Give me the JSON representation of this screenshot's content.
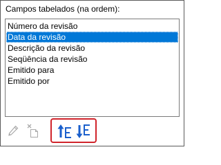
{
  "fields_group": {
    "label": "Campos tabelados (na ordem):",
    "items": [
      {
        "label": "Número da revisão",
        "selected": false
      },
      {
        "label": "Data da revisão",
        "selected": true
      },
      {
        "label": "Descrição da revisão",
        "selected": false
      },
      {
        "label": "Seqüência da revisão",
        "selected": false
      },
      {
        "label": "Emitido para",
        "selected": false
      },
      {
        "label": "Emitido por",
        "selected": false
      }
    ]
  },
  "toolbar": {
    "edit_icon": "pencil-icon",
    "delete_icon": "delete-item-icon",
    "move_up_icon": "move-up-icon",
    "move_down_icon": "move-down-icon"
  },
  "colors": {
    "selection": "#0078d7",
    "accent_blue": "#1a5fcc",
    "highlight_border": "#d0232a",
    "disabled_icon": "#a8a8a8"
  }
}
